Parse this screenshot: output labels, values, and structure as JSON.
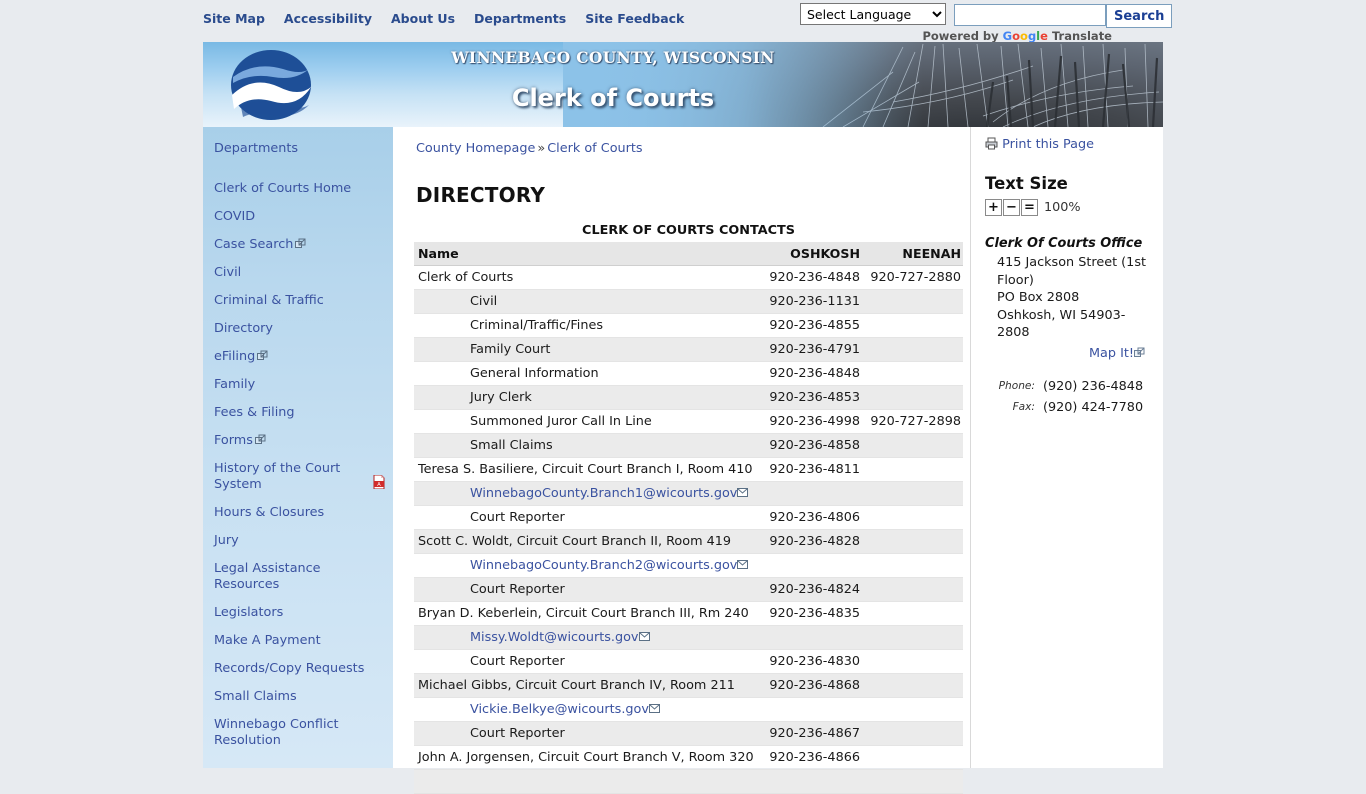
{
  "topbar": {
    "nav": [
      {
        "label": "Site Map",
        "name": "site-map"
      },
      {
        "label": "Accessibility",
        "name": "accessibility"
      },
      {
        "label": "About Us",
        "name": "about-us"
      },
      {
        "label": "Departments",
        "name": "departments"
      },
      {
        "label": "Site Feedback",
        "name": "site-feedback"
      }
    ],
    "language_selected": "Select Language",
    "search_value": "",
    "search_placeholder": "",
    "search_button": "Search",
    "powered_by_prefix": "Powered by ",
    "google_letters": [
      "G",
      "o",
      "o",
      "g",
      "l",
      "e"
    ],
    "translate_word": " Translate"
  },
  "banner": {
    "county": "WINNEBAGO COUNTY, WISCONSIN",
    "department": "Clerk of Courts"
  },
  "sidebar": {
    "top_item": {
      "label": "Departments",
      "name": "sidebar-item-departments"
    },
    "items": [
      {
        "label": "Clerk of Courts Home",
        "icon": "",
        "name": "clerk-of-courts-home"
      },
      {
        "label": "COVID",
        "icon": "",
        "name": "covid"
      },
      {
        "label": "Case Search",
        "icon": "external-link",
        "name": "case-search"
      },
      {
        "label": "Civil",
        "icon": "",
        "name": "civil"
      },
      {
        "label": "Criminal & Traffic",
        "icon": "",
        "name": "criminal-and-traffic"
      },
      {
        "label": "Directory",
        "icon": "",
        "name": "directory"
      },
      {
        "label": "eFiling",
        "icon": "external-link",
        "name": "efiling"
      },
      {
        "label": "Family",
        "icon": "",
        "name": "family"
      },
      {
        "label": "Fees & Filing",
        "icon": "",
        "name": "fees-and-filing"
      },
      {
        "label": "Forms",
        "icon": "external-link",
        "name": "forms"
      },
      {
        "label": "History of the Court System",
        "icon": "pdf",
        "name": "history-of-the-court-system"
      },
      {
        "label": "Hours & Closures",
        "icon": "",
        "name": "hours-and-closures"
      },
      {
        "label": "Jury",
        "icon": "",
        "name": "jury"
      },
      {
        "label": "Legal Assistance Resources",
        "icon": "",
        "name": "legal-assistance-resources"
      },
      {
        "label": "Legislators",
        "icon": "",
        "name": "legislators"
      },
      {
        "label": "Make A Payment",
        "icon": "",
        "name": "make-a-payment"
      },
      {
        "label": "Records/Copy Requests",
        "icon": "",
        "name": "records-copy-requests"
      },
      {
        "label": "Small Claims",
        "icon": "",
        "name": "small-claims"
      },
      {
        "label": "Winnebago Conflict Resolution",
        "icon": "",
        "name": "winnebago-conflict-resolution"
      }
    ]
  },
  "breadcrumb": {
    "home": "County Homepage",
    "separator": "»",
    "current": "Clerk of Courts"
  },
  "main": {
    "title": "DIRECTORY",
    "table": {
      "caption": "CLERK OF COURTS CONTACTS",
      "headers": [
        "Name",
        "OSHKOSH",
        "NEENAH"
      ],
      "rows": [
        {
          "type": "plain",
          "name": "Clerk of Courts",
          "oshkosh": "920-236-4848",
          "neenah": "920-727-2880"
        },
        {
          "type": "indent",
          "name": "Civil",
          "oshkosh": "920-236-1131",
          "neenah": ""
        },
        {
          "type": "indent",
          "name": "Criminal/Traffic/Fines",
          "oshkosh": "920-236-4855",
          "neenah": ""
        },
        {
          "type": "indent",
          "name": "Family Court",
          "oshkosh": "920-236-4791",
          "neenah": ""
        },
        {
          "type": "indent",
          "name": "General Information",
          "oshkosh": "920-236-4848",
          "neenah": ""
        },
        {
          "type": "indent",
          "name": "Jury Clerk",
          "oshkosh": "920-236-4853",
          "neenah": ""
        },
        {
          "type": "indent",
          "name": "Summoned Juror Call In Line",
          "oshkosh": "920-236-4998",
          "neenah": "920-727-2898"
        },
        {
          "type": "indent",
          "name": "Small Claims",
          "oshkosh": "920-236-4858",
          "neenah": ""
        },
        {
          "type": "plain",
          "name": "Teresa S. Basiliere, Circuit Court Branch I, Room 410",
          "oshkosh": "920-236-4811",
          "neenah": ""
        },
        {
          "type": "email",
          "name": "WinnebagoCounty.Branch1@wicourts.gov",
          "oshkosh": "",
          "neenah": ""
        },
        {
          "type": "indent",
          "name": "Court Reporter",
          "oshkosh": "920-236-4806",
          "neenah": ""
        },
        {
          "type": "plain",
          "name": "Scott C. Woldt, Circuit Court Branch II, Room 419",
          "oshkosh": "920-236-4828",
          "neenah": ""
        },
        {
          "type": "email",
          "name": "WinnebagoCounty.Branch2@wicourts.gov",
          "oshkosh": "",
          "neenah": ""
        },
        {
          "type": "indent",
          "name": "Court Reporter",
          "oshkosh": "920-236-4824",
          "neenah": ""
        },
        {
          "type": "plain",
          "name": "Bryan D. Keberlein, Circuit Court Branch III, Rm 240",
          "oshkosh": "920-236-4835",
          "neenah": ""
        },
        {
          "type": "email",
          "name": "Missy.Woldt@wicourts.gov",
          "oshkosh": "",
          "neenah": ""
        },
        {
          "type": "indent",
          "name": "Court Reporter",
          "oshkosh": "920-236-4830",
          "neenah": ""
        },
        {
          "type": "plain",
          "name": "Michael Gibbs, Circuit Court Branch IV, Room 211",
          "oshkosh": "920-236-4868",
          "neenah": ""
        },
        {
          "type": "email",
          "name": "Vickie.Belkye@wicourts.gov",
          "oshkosh": "",
          "neenah": ""
        },
        {
          "type": "indent",
          "name": "Court Reporter",
          "oshkosh": "920-236-4867",
          "neenah": ""
        },
        {
          "type": "plain",
          "name": "John A. Jorgensen, Circuit Court Branch V, Room 320",
          "oshkosh": "920-236-4866",
          "neenah": ""
        },
        {
          "type": "email",
          "name": "",
          "oshkosh": "",
          "neenah": ""
        }
      ]
    }
  },
  "rightcol": {
    "print_label": "Print this Page",
    "text_size_heading": "Text Size",
    "ts_increase": "+",
    "ts_decrease": "−",
    "ts_reset": "=",
    "ts_percent": "100%",
    "office_name": "Clerk Of Courts Office",
    "address_lines": [
      "415 Jackson Street (1st Floor)",
      "PO Box 2808",
      "Oshkosh, WI 54903-2808"
    ],
    "map_label": "Map It!",
    "phone_label": "Phone:",
    "phone_value": "(920) 236-4848",
    "fax_label": "Fax:",
    "fax_value": "(920) 424-7780"
  },
  "colors": {
    "link": "#3a52a0",
    "topnav_link": "#2a4b8d",
    "sidebar_top": "#a8cfe9",
    "sidebar_bottom": "#d6e8f6",
    "page_bg": "#e8ebef",
    "row_alt": "#ebebeb",
    "table_header_bg": "#e6e6e6"
  }
}
